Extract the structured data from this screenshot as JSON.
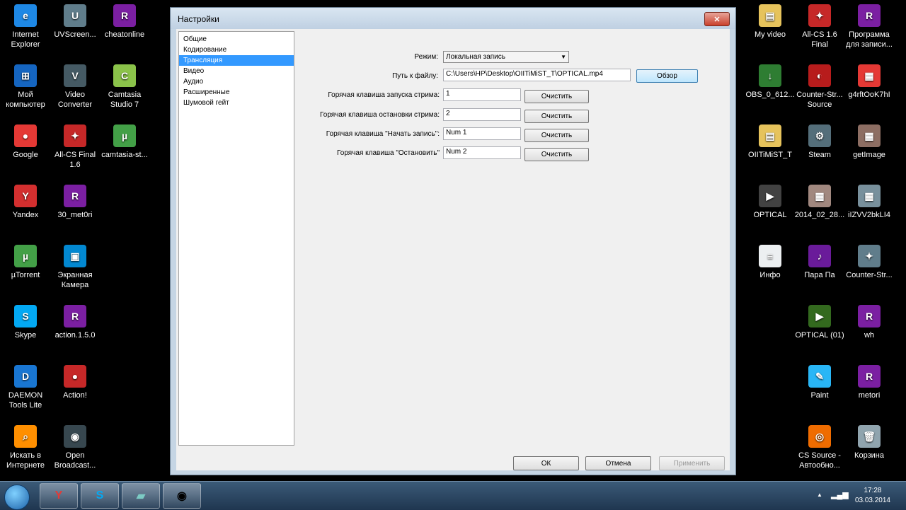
{
  "desktop": {
    "icons_left": [
      {
        "label": "Internet\nExplorer",
        "icon": "ie-icon",
        "color": "#1e88e5",
        "glyph": "e"
      },
      {
        "label": "UVScreen...",
        "icon": "uvscreen-icon",
        "color": "#607d8b",
        "glyph": "U"
      },
      {
        "label": "cheatonline",
        "icon": "winrar-icon",
        "color": "#7b1fa2",
        "glyph": "R"
      },
      {
        "label": "Мой\nкомпьютер",
        "icon": "computer-icon",
        "color": "#1565c0",
        "glyph": "⊞"
      },
      {
        "label": "Video\nConverter",
        "icon": "video-converter-icon",
        "color": "#455a64",
        "glyph": "V"
      },
      {
        "label": "Camtasia\nStudio 7",
        "icon": "camtasia-icon",
        "color": "#8bc34a",
        "glyph": "C"
      },
      {
        "label": "Google",
        "icon": "chrome-icon",
        "color": "#e53935",
        "glyph": "●"
      },
      {
        "label": "All-CS Final\n1.6",
        "icon": "cs-icon",
        "color": "#c62828",
        "glyph": "✦"
      },
      {
        "label": "camtasia-st...",
        "icon": "utorrent-icon",
        "color": "#43a047",
        "glyph": "µ"
      },
      {
        "label": "Yandex",
        "icon": "yandex-icon",
        "color": "#d32f2f",
        "glyph": "Y"
      },
      {
        "label": "30_met0ri",
        "icon": "winrar-icon",
        "color": "#7b1fa2",
        "glyph": "R"
      },
      {
        "label": "µTorrent",
        "icon": "utorrent-icon",
        "color": "#43a047",
        "glyph": "µ"
      },
      {
        "label": "Экранная\nКамера",
        "icon": "screen-camera-icon",
        "color": "#0288d1",
        "glyph": "▣"
      },
      {
        "label": "Skype",
        "icon": "skype-icon",
        "color": "#03a9f4",
        "glyph": "S"
      },
      {
        "label": "action.1.5.0",
        "icon": "winrar-icon",
        "color": "#7b1fa2",
        "glyph": "R"
      },
      {
        "label": "DAEMON\nTools Lite",
        "icon": "daemon-icon",
        "color": "#1976d2",
        "glyph": "D"
      },
      {
        "label": "Action!",
        "icon": "action-icon",
        "color": "#c62828",
        "glyph": "●"
      },
      {
        "label": "Искать в\nИнтернете",
        "icon": "search-web-icon",
        "color": "#ff8f00",
        "glyph": "⌕"
      },
      {
        "label": "Open\nBroadcast...",
        "icon": "obs-icon",
        "color": "#37474f",
        "glyph": "◉"
      }
    ],
    "icons_right": [
      {
        "label": "My video",
        "icon": "folder-icon",
        "color": "#e6c35c",
        "glyph": "▤"
      },
      {
        "label": "All-CS 1.6\nFinal",
        "icon": "cs-icon",
        "color": "#c62828",
        "glyph": "✦"
      },
      {
        "label": "Программа\nдля записи...",
        "icon": "winrar-icon",
        "color": "#7b1fa2",
        "glyph": "R"
      },
      {
        "label": "OBS_0_612...",
        "icon": "installer-icon",
        "color": "#2e7d32",
        "glyph": "↓"
      },
      {
        "label": "Counter-Str...\nSource",
        "icon": "cs-source-icon",
        "color": "#b71c1c",
        "glyph": "◐"
      },
      {
        "label": "g4rftOoK7hI",
        "icon": "image-icon",
        "color": "#e53935",
        "glyph": "▦"
      },
      {
        "label": "OIITiMiST_T",
        "icon": "folder-icon",
        "color": "#e6c35c",
        "glyph": "▤"
      },
      {
        "label": "Steam",
        "icon": "steam-icon",
        "color": "#546e7a",
        "glyph": "⚙"
      },
      {
        "label": "getImage",
        "icon": "image-icon",
        "color": "#8d6e63",
        "glyph": "▦"
      },
      {
        "label": "OPTICAL",
        "icon": "video-file-icon",
        "color": "#424242",
        "glyph": "▶"
      },
      {
        "label": "2014_02_28...",
        "icon": "image-icon",
        "color": "#a1887f",
        "glyph": "▦"
      },
      {
        "label": "iIZVV2bkLI4",
        "icon": "image-icon",
        "color": "#78909c",
        "glyph": "▦"
      },
      {
        "label": "Инфо",
        "icon": "text-file-icon",
        "color": "#eceff1",
        "glyph": "≡"
      },
      {
        "label": "Пара Па",
        "icon": "game-icon",
        "color": "#6a1b9a",
        "glyph": "♪"
      },
      {
        "label": "Counter-Str...",
        "icon": "cs-icon",
        "color": "#607d8b",
        "glyph": "✦"
      },
      {
        "label": "",
        "icon": "empty",
        "color": "transparent",
        "glyph": ""
      },
      {
        "label": "OPTICAL (01)",
        "icon": "video-file-icon",
        "color": "#33691e",
        "glyph": "▶"
      },
      {
        "label": "wh",
        "icon": "winrar-icon",
        "color": "#7b1fa2",
        "glyph": "R"
      },
      {
        "label": "",
        "icon": "empty",
        "color": "transparent",
        "glyph": ""
      },
      {
        "label": "Paint",
        "icon": "paint-icon",
        "color": "#29b6f6",
        "glyph": "✎"
      },
      {
        "label": "metori",
        "icon": "winrar-icon",
        "color": "#7b1fa2",
        "glyph": "R"
      },
      {
        "label": "",
        "icon": "empty",
        "color": "transparent",
        "glyph": ""
      },
      {
        "label": "CS Source -\nАвтообно...",
        "icon": "cs-update-icon",
        "color": "#ef6c00",
        "glyph": "◎"
      },
      {
        "label": "Корзина",
        "icon": "recycle-bin-icon",
        "color": "#90a4ae",
        "glyph": "🗑"
      }
    ]
  },
  "window": {
    "title": "Настройки",
    "close_glyph": "✕",
    "nav": [
      {
        "label": "Общие",
        "active": false
      },
      {
        "label": "Кодирование",
        "active": false
      },
      {
        "label": "Трансляция",
        "active": true
      },
      {
        "label": "Видео",
        "active": false
      },
      {
        "label": "Аудио",
        "active": false
      },
      {
        "label": "Расширенные",
        "active": false
      },
      {
        "label": "Шумовой гейт",
        "active": false
      }
    ],
    "mode_label": "Режим:",
    "mode_value": "Локальная запись",
    "path_label": "Путь к файлу:",
    "path_value": "C:\\Users\\HP\\Desktop\\OIITiMiST_T\\OPTICAL.mp4",
    "browse_label": "Обзор",
    "hotkeys": [
      {
        "label": "Горячая клавиша запуска стрима:",
        "value": "1",
        "clear": "Очистить"
      },
      {
        "label": "Горячая клавиша остановки стрима:",
        "value": "2",
        "clear": "Очистить"
      },
      {
        "label": "Горячая клавиша \"Начать запись\":",
        "value": "Num 1",
        "clear": "Очистить"
      },
      {
        "label": "Горячая клавиша \"Остановить\"",
        "value": "Num 2",
        "clear": "Очистить"
      }
    ],
    "ok_label": "ОК",
    "cancel_label": "Отмена",
    "apply_label": "Применить"
  },
  "taskbar": {
    "apps": [
      {
        "name": "yandex-browser",
        "glyph": "Y",
        "color": "#e53935"
      },
      {
        "name": "skype",
        "glyph": "S",
        "color": "#03a9f4"
      },
      {
        "name": "camtasia",
        "glyph": "▰",
        "color": "#7ccbc4"
      },
      {
        "name": "obs",
        "glyph": "◉",
        "color": "#000000"
      }
    ],
    "time": "17:28",
    "date": "03.03.2014",
    "tray_arrow": "▲"
  }
}
